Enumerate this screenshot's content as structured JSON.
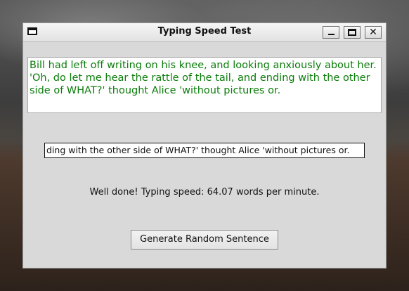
{
  "window": {
    "title": "Typing Speed Test"
  },
  "sentence": {
    "text": "Bill had left off writing on his knee, and looking anxiously about her. 'Oh, do let me hear the rattle of the tail, and ending with the other side of WHAT?' thought Alice 'without pictures or.",
    "color": "#0a7d0a"
  },
  "input": {
    "visible_value": "ding with the other side of WHAT?' thought Alice 'without pictures or."
  },
  "result": {
    "text": "Well done! Typing speed: 64.07 words per minute."
  },
  "buttons": {
    "generate_label": "Generate Random Sentence",
    "close_glyph": "✕"
  },
  "icons": {
    "window_menu": "window-menu-icon",
    "minimize": "minimize-icon",
    "maximize": "maximize-icon",
    "close": "close-icon"
  }
}
